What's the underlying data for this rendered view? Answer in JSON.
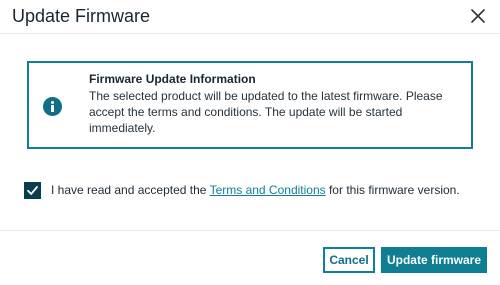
{
  "dialog": {
    "title": "Update Firmware",
    "close_icon": "close-icon"
  },
  "info": {
    "icon": "info-icon",
    "heading": "Firmware Update Information",
    "text": "The selected product will be updated to the latest firmware. Please accept the terms and conditions. The update will be started immediately."
  },
  "consent": {
    "checked": true,
    "text_before": "I have read and accepted the ",
    "link_text": "Terms and Conditions",
    "text_after": " for this firmware version."
  },
  "actions": {
    "cancel_label": "Cancel",
    "update_label": "Update firmware"
  },
  "colors": {
    "accent": "#0e7e93",
    "checkbox": "#0a3d52"
  }
}
